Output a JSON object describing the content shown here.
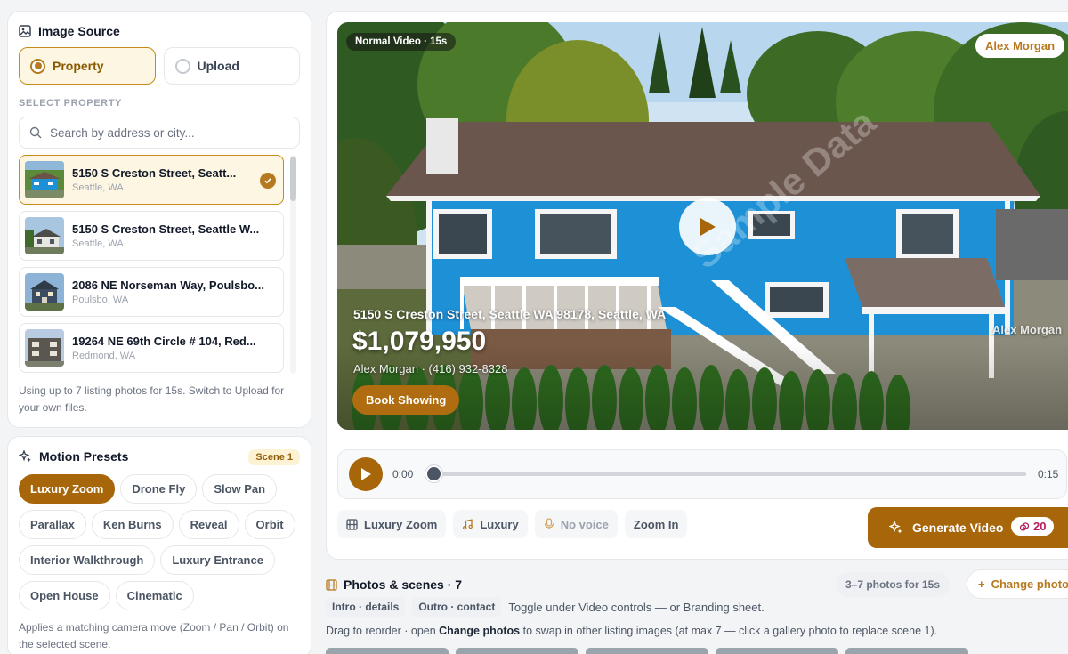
{
  "image_source": {
    "title": "Image Source",
    "option_property": "Property",
    "option_upload": "Upload",
    "selected": "Property",
    "select_label": "SELECT PROPERTY",
    "search_placeholder": "Search by address or city...",
    "properties": [
      {
        "title": "5150 S Creston Street, Seatt...",
        "sub": "Seattle, WA",
        "selected": true
      },
      {
        "title": "5150 S Creston Street, Seattle W...",
        "sub": "Seattle, WA",
        "selected": false
      },
      {
        "title": "2086 NE Norseman Way, Poulsbo...",
        "sub": "Poulsbo, WA",
        "selected": false
      },
      {
        "title": "19264 NE 69th Circle # 104, Red...",
        "sub": "Redmond, WA",
        "selected": false
      }
    ],
    "note": "Using up to 7 listing photos for 15s. Switch to Upload for your own files."
  },
  "motion_presets": {
    "title": "Motion Presets",
    "scene_badge": "Scene 1",
    "presets": [
      "Luxury Zoom",
      "Drone Fly",
      "Slow Pan",
      "Parallax",
      "Ken Burns",
      "Reveal",
      "Orbit",
      "Interior Walkthrough",
      "Luxury Entrance",
      "Open House",
      "Cinematic"
    ],
    "active": "Luxury Zoom",
    "note": "Applies a matching camera move (Zoom / Pan / Orbit) on the selected scene."
  },
  "video": {
    "mode_badge": "Normal Video · 15s",
    "agent_badge": "Alex Morgan",
    "address": "5150 S Creston Street, Seattle WA 98178, Seattle, WA",
    "price": "$1,079,950",
    "agent_line": "Alex Morgan · (416) 932-8328",
    "cta": "Book Showing",
    "watermark": "Sample Data",
    "watermark_name": "Alex Morgan"
  },
  "player": {
    "current_time": "0:00",
    "end_time": "0:15",
    "progress": 0
  },
  "options": {
    "preset": "Luxury Zoom",
    "music": "Luxury",
    "voice": "No voice",
    "zoom": "Zoom In"
  },
  "generate": {
    "label": "Generate Video",
    "credits": "20"
  },
  "photos": {
    "title": "Photos & scenes · 7",
    "range_badge": "3–7 photos for 15s",
    "change_label": "Change photos",
    "intro_tag": "Intro · details",
    "outro_tag": "Outro · contact",
    "toggle_note": "Toggle under Video controls — or Branding sheet.",
    "drag_note_a": "Drag to reorder · open ",
    "drag_note_bold": "Change photos",
    "drag_note_b": " to swap in other listing images (at max 7 — click a gallery photo to replace scene 1)."
  },
  "colors": {
    "accent": "#a8660b",
    "accent_light": "#fdf6e3",
    "credit_pink": "#b91c5c",
    "house_blue": "#1e90d6"
  }
}
